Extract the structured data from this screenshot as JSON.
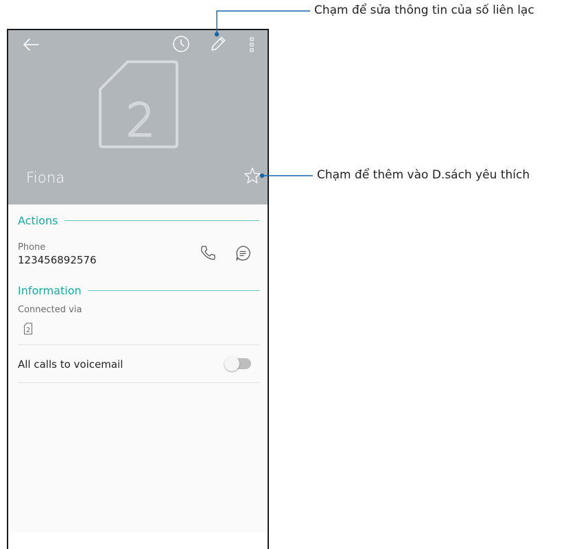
{
  "callouts": {
    "edit": "Chạm để sửa thông tin của số liên lạc",
    "favorite": "Chạm để thêm vào D.sách yêu thích"
  },
  "contact": {
    "name": "Fiona",
    "avatar_digit": "2"
  },
  "actions": {
    "title": "Actions",
    "phone_label": "Phone",
    "phone_number": "123456892576"
  },
  "information": {
    "title": "Information",
    "connected_label": "Connected via",
    "sim_slot": "2"
  },
  "settings": {
    "voicemail_label": "All calls to voicemail",
    "voicemail_on": false
  },
  "colors": {
    "header_bg": "#b0b6ba",
    "accent": "#1aa9a4",
    "callout_line": "#1565a8"
  },
  "icons": [
    "back-arrow-icon",
    "history-icon",
    "edit-pencil-icon",
    "more-vert-icon",
    "sim-card-icon",
    "star-icon",
    "phone-icon",
    "message-icon"
  ]
}
